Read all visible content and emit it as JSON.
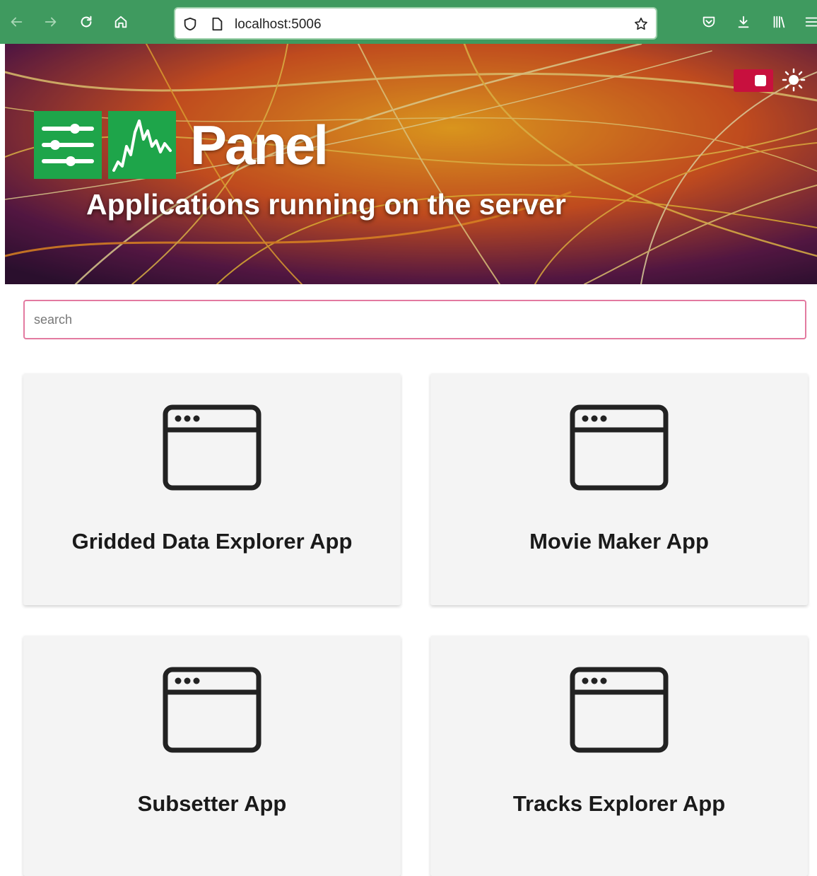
{
  "browser": {
    "url": "localhost:5006",
    "accent_color": "#3f9a5f"
  },
  "hero": {
    "logo_text": "Panel",
    "title": "Applications running on the server",
    "toggle_color": "#c8103e"
  },
  "search": {
    "placeholder": "search",
    "value": ""
  },
  "apps": [
    {
      "title": "Gridded Data Explorer App",
      "icon": "browser-window-icon"
    },
    {
      "title": "Movie Maker App",
      "icon": "browser-window-icon"
    },
    {
      "title": "Subsetter App",
      "icon": "browser-window-icon"
    },
    {
      "title": "Tracks Explorer App",
      "icon": "browser-window-icon"
    }
  ]
}
